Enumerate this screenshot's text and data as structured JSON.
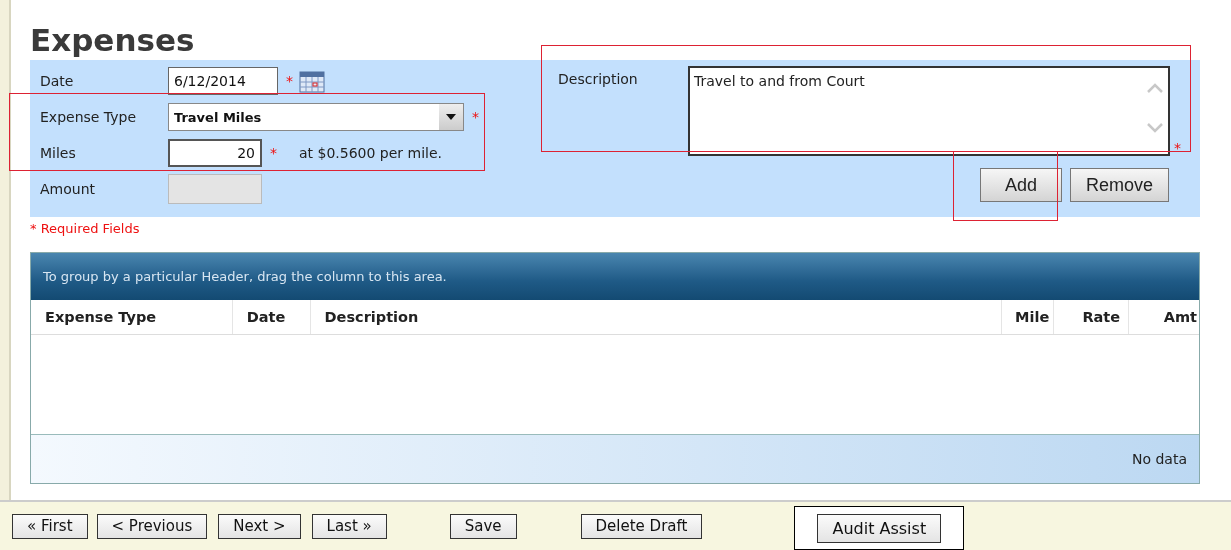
{
  "title": "Expenses",
  "fields": [
    {
      "kind": "date",
      "label": "Date",
      "value": "6/12/2014",
      "required_mark": "*"
    },
    {
      "kind": "dropdown",
      "label": "Expense Type",
      "value": "Travel Miles",
      "required_mark": "*"
    },
    {
      "kind": "number",
      "label": "Miles",
      "value": "20",
      "required_mark": "*",
      "note": "at $0.5600 per mile."
    },
    {
      "kind": "text",
      "label": "Amount",
      "disabled": true
    }
  ],
  "description": {
    "label": "Description",
    "value": "Travel to and from Court",
    "required_mark": "*"
  },
  "form_buttons": [
    "Add",
    "Remove"
  ],
  "required_note": "* Required Fields",
  "grid": {
    "group_hint": "To group by a particular Header, drag the column to this area.",
    "columns": [
      "Expense Type",
      "Date",
      "Description",
      "Mile",
      "Rate",
      "Amt"
    ],
    "empty_text": "No data"
  },
  "footer_buttons": [
    {
      "label": "« First",
      "highlighted": false
    },
    {
      "label": "< Previous",
      "highlighted": false
    },
    {
      "label": "Next >",
      "highlighted": false
    },
    {
      "label": "Last »",
      "highlighted": false
    },
    {
      "label": "Save",
      "highlighted": false
    },
    {
      "label": "Delete Draft",
      "highlighted": false
    },
    {
      "label": "Audit Assist",
      "highlighted": true
    }
  ]
}
